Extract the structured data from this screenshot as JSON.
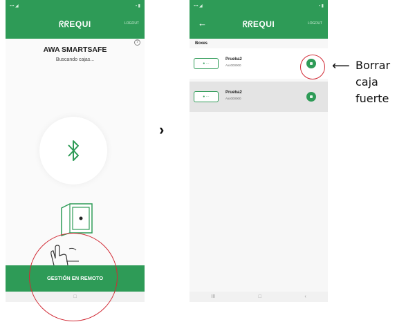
{
  "left_screen": {
    "brand": "ᖇᖇEQUI",
    "logout": "LOGOUT",
    "title": "AWA SMARTSAFE",
    "status": "Buscando cajas...",
    "remote_button": "GESTIÓN EN REMOTO",
    "nav": [
      "□"
    ]
  },
  "arrow": "›",
  "right_screen": {
    "brand": "ᖇᖇEQUI",
    "logout": "LOGOUT",
    "section_title": "Boxes",
    "boxes": [
      {
        "name": "Prueba2",
        "id": "Axx000000",
        "badge": "● ···"
      },
      {
        "name": "Prueba2",
        "id": "Axx000000",
        "badge": "● ···"
      }
    ],
    "nav": [
      "III",
      "□",
      "‹"
    ]
  },
  "callout": {
    "arrow": "⟵",
    "lines": [
      "Borrar",
      "caja",
      "fuerte"
    ]
  },
  "colors": {
    "primary": "#2e9b57",
    "highlight": "#d12a35"
  }
}
